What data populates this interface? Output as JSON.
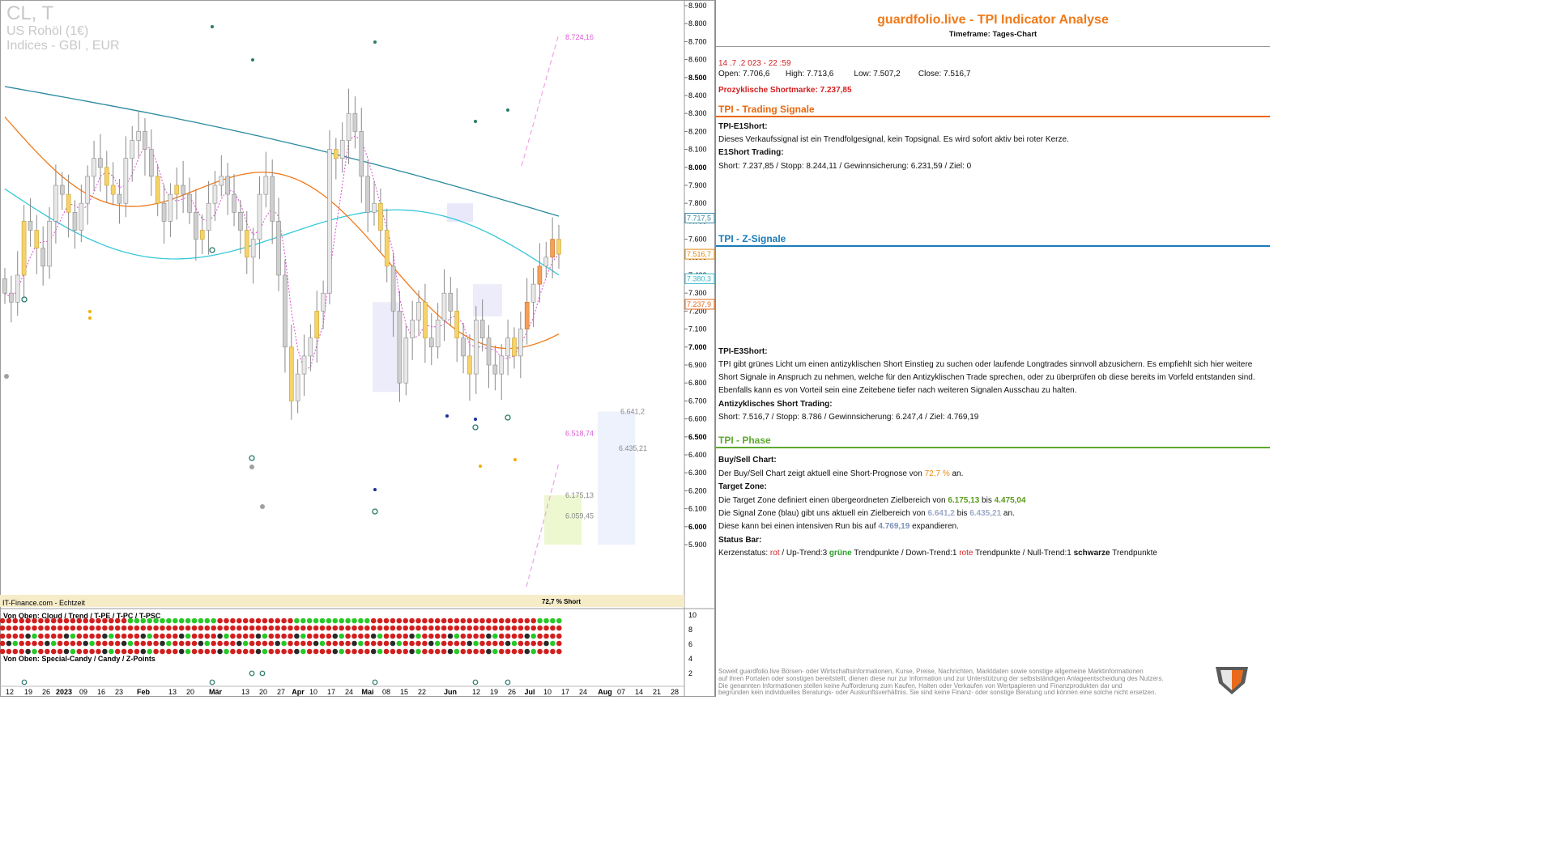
{
  "chart": {
    "symbol": "CL, T",
    "name": "US Rohöl (1€)",
    "exchange": "Indices - GBI , EUR",
    "source_label": "IT-Finance.com - Echtzeit",
    "forecast_label": "72,7 % Short",
    "subpanel_top_label": "Von Oben: Cloud / Trend / T-PE / T-PC / T-PSC",
    "subpanel_bottom_label": "Von Oben: Special-Candy / Candy / Z-Points",
    "price_ticks": [
      "8.900",
      "8.800",
      "8.700",
      "8.600",
      "8.500",
      "8.400",
      "8.300",
      "8.200",
      "8.100",
      "8.000",
      "7.900",
      "7.800",
      "7.700",
      "7.600",
      "7.500",
      "7.400",
      "7.300",
      "7.200",
      "7.100",
      "7.000",
      "6.900",
      "6.800",
      "6.700",
      "6.600",
      "6.500",
      "6.400",
      "6.300",
      "6.200",
      "6.100",
      "6.000",
      "5.900"
    ],
    "bold_ticks": [
      "8.500",
      "8.000",
      "7.500",
      "7.000",
      "6.500",
      "6.000"
    ],
    "price_tags": [
      {
        "value": "7.717,5",
        "price": 7717.5,
        "color": "#3a8ea6"
      },
      {
        "value": "7.516,7",
        "price": 7516.7,
        "color": "#e08a10"
      },
      {
        "value": "7.380,3",
        "price": 7380.3,
        "color": "#3ab6c8"
      },
      {
        "value": "7.237,9",
        "price": 7237.9,
        "color": "#e86a1a"
      }
    ],
    "level_labels": [
      {
        "text": "8.724,16",
        "price": 8724.16,
        "color": "#e05ad8",
        "x": 698
      },
      {
        "text": "6.518,74",
        "price": 6518.74,
        "color": "#e05ad8",
        "x": 698
      },
      {
        "text": "6.641,2",
        "price": 6641.2,
        "color": "#888888",
        "x": 766
      },
      {
        "text": "6.435,21",
        "price": 6435.21,
        "color": "#888888",
        "x": 764
      },
      {
        "text": "6.175,13",
        "price": 6175.13,
        "color": "#888888",
        "x": 698
      },
      {
        "text": "6.059,45",
        "price": 6059.45,
        "color": "#888888",
        "x": 698
      }
    ],
    "subpanel_ticks": [
      "10",
      "8",
      "6",
      "4",
      "2"
    ],
    "x_labels": [
      {
        "t": "12",
        "x": 12
      },
      {
        "t": "19",
        "x": 35
      },
      {
        "t": "26",
        "x": 57
      },
      {
        "t": "2023",
        "x": 79,
        "bold": true
      },
      {
        "t": "09",
        "x": 103
      },
      {
        "t": "16",
        "x": 125
      },
      {
        "t": "23",
        "x": 147
      },
      {
        "t": "Feb",
        "x": 177,
        "bold": true
      },
      {
        "t": "13",
        "x": 213
      },
      {
        "t": "20",
        "x": 235
      },
      {
        "t": "Mär",
        "x": 266,
        "bold": true
      },
      {
        "t": "13",
        "x": 303
      },
      {
        "t": "20",
        "x": 325
      },
      {
        "t": "27",
        "x": 347
      },
      {
        "t": "Apr",
        "x": 368,
        "bold": true
      },
      {
        "t": "10",
        "x": 387
      },
      {
        "t": "17",
        "x": 409
      },
      {
        "t": "24",
        "x": 431
      },
      {
        "t": "Mai",
        "x": 454,
        "bold": true
      },
      {
        "t": "08",
        "x": 477
      },
      {
        "t": "15",
        "x": 499
      },
      {
        "t": "22",
        "x": 521
      },
      {
        "t": "Jun",
        "x": 556,
        "bold": true
      },
      {
        "t": "12",
        "x": 588
      },
      {
        "t": "19",
        "x": 610
      },
      {
        "t": "26",
        "x": 632
      },
      {
        "t": "Jul",
        "x": 654,
        "bold": true
      },
      {
        "t": "10",
        "x": 676
      },
      {
        "t": "17",
        "x": 698
      },
      {
        "t": "24",
        "x": 720
      },
      {
        "t": "Aug",
        "x": 747,
        "bold": true
      },
      {
        "t": "07",
        "x": 767
      },
      {
        "t": "14",
        "x": 789
      },
      {
        "t": "21",
        "x": 811
      },
      {
        "t": "28",
        "x": 833
      }
    ]
  },
  "chart_data": {
    "type": "candlestick",
    "title": "",
    "series": [
      {
        "name": "Close",
        "values": [
          7300,
          7250,
          7400,
          7700,
          7650,
          7550,
          7450,
          7700,
          7900,
          7850,
          7750,
          7650,
          7800,
          7950,
          8050,
          8000,
          7900,
          7850,
          7800,
          8050,
          8150,
          8200,
          8100,
          7950,
          7800,
          7700,
          7850,
          7900,
          7850,
          7750,
          7600,
          7650,
          7800,
          7900,
          7950,
          7850,
          7750,
          7650,
          7500,
          7600,
          7850,
          7950,
          7700,
          7400,
          7000,
          6700,
          6850,
          6950,
          7050,
          7200,
          7300,
          8100,
          8050,
          8150,
          8300,
          8200,
          7950,
          7750,
          7800,
          7650,
          7450,
          7200,
          6800,
          7050,
          7150,
          7250,
          7050,
          7000,
          7150,
          7300,
          7200,
          7050,
          6950,
          6850,
          7150,
          7050,
          6900,
          6850,
          6950,
          7050,
          6950,
          7100,
          7250,
          7350,
          7450,
          7500,
          7600,
          7516.7
        ]
      }
    ],
    "moving_averages": [
      {
        "name": "cyan",
        "from": 7880,
        "to": 7380
      },
      {
        "name": "teal",
        "from": 8450,
        "to": 7717.5
      },
      {
        "name": "orange",
        "from": 8200,
        "to": 7237.9
      }
    ],
    "ylim": [
      5900,
      8900
    ],
    "signal_levels": [
      8724.16,
      6518.74,
      6641.2,
      6435.21,
      6175.13,
      6059.45
    ],
    "forecast": "72,7 % Short"
  },
  "panel": {
    "title": "guardfolio.live - TPI Indicator Analyse",
    "timeframe": "Timeframe: Tages-Chart",
    "datetime": "14 .7 .2 023  - 22 :59",
    "ohlc": {
      "open_label": "Open:",
      "open": "7.706,6",
      "high_label": "High:",
      "high": "7.713,6",
      "low_label": "Low:",
      "low": "7.507,2",
      "close_label": "Close:",
      "close": "7.516,7"
    },
    "shortmark": "Prozyklische Shortmarke: 7.237,85",
    "sec_trading": "TPI - Trading Signale",
    "e1_title": "TPI-E1Short:",
    "e1_text": "Dieses Verkaufssignal ist ein Trendfolgesignal, kein Topsignal. Es wird sofort aktiv bei roter Kerze.",
    "e1_trading_title": "E1Short Trading:",
    "e1_trading": "Short:  7.237,85    / Stopp:   8.244,11    / Gewinnsicherung:   6.231,59   / Ziel:        0",
    "sec_z": "TPI - Z-Signale",
    "e3_title": "TPI-E3Short:",
    "e3_lines": [
      "TPI gibt grünes Licht um einen antizyklischen Short Einstieg zu suchen oder laufende Longtrades sinnvoll abzusichern. Es empfiehlt sich hier weitere",
      "Short Signale in Anspruch zu nehmen, welche für den Antizyklischen Trade sprechen, oder zu überprüfen ob diese bereits im Vorfeld entstanden sind.",
      "Ebenfalls kann es von Vorteil sein eine Zeitebene tiefer nach weiteren Signalen Ausschau zu halten."
    ],
    "anti_title": "Antizyklisches Short Trading:",
    "anti_trading": "Short:   7.516,7     / Stopp:      8.786       / Gewinnsicherung:     6.247,4    / Ziel: 4.769,19",
    "sec_phase": "TPI - Phase",
    "bs_title": "Buy/Sell Chart:",
    "bs_pre": "Der Buy/Sell Chart zeigt aktuell eine Short-Prognose von ",
    "bs_val": "72,7 %",
    "bs_post": " an.",
    "tz_title": "Target Zone:",
    "tz_pre": "Die Target Zone definiert einen übergeordneten Zielbereich von  ",
    "tz_v1": "6.175,13",
    "tz_mid": "   bis  ",
    "tz_v2": "4.475,04",
    "sz_pre": "Die Signal Zone (blau) gibt uns aktuell ein Zielbereich von    ",
    "sz_v1": "6.641,2",
    "sz_mid": "     bis    ",
    "sz_v2": "6.435,21",
    "sz_post": "    an.",
    "run_pre": "Diese kann bei einen intensiven Run bis auf   ",
    "run_v": "4.769,19",
    "run_post": "   expandieren.",
    "status_title": "Status Bar:",
    "status_pre": "Kerzenstatus:      ",
    "status_rot": "rot",
    "status_up": "       / Up-Trend:3 ",
    "status_gruene": "grüne",
    "status_tp1": " Trendpunkte   / Down-Trend:1 ",
    "status_rote": "rote",
    "status_tp2": " Trendpunkte / Null-Trend:1 ",
    "status_schwarze": "schwarze",
    "status_tp3": " Trendpunkte",
    "disclaimer": "Soweit guardfolio.live Börsen- oder Wirtschaftsinformationen, Kurse, Preise, Nachrichten, Marktdaten sowie sonstige allgemeine Marktinformationen\nauf ihren Portalen oder sonstigen bereitstellt, dienen diese nur zur Information und zur Unterstützung der selbstständigen Anlageentscheidung des Nutzers.\nDie genannten Informationen stellen keine Aufforderung zum Kaufen, Halten oder Verkaufen von Wertpapieren und Finanzprodukten dar und\nbegründen kein individuelles Beratungs- oder Auskunftsverhältnis. Sie sind keine Finanz- oder sonstige Beratung und können eine solche nicht ersetzen."
  },
  "colors": {
    "accent_orange": "#f07a1a",
    "trading_line": "#e8680e",
    "z_line": "#1a7ab8",
    "phase_line": "#5caa2e",
    "red": "#d21f1f",
    "green": "#28a028"
  }
}
